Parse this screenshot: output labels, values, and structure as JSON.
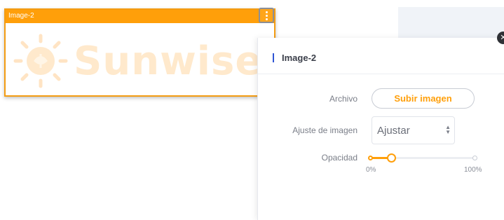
{
  "widget": {
    "title": "Image-2",
    "logo_text": "Sunwise",
    "logo_color": "#ffe9cc",
    "menu_icon": "more-vertical-icon"
  },
  "panel": {
    "title": "Image-2",
    "close_icon": "close-icon",
    "fields": {
      "file_label": "Archivo",
      "upload_label": "Subir imagen",
      "fit_label": "Ajuste de imagen",
      "fit_value": "Ajustar",
      "opacity_label": "Opacidad",
      "opacity_min": "0%",
      "opacity_max": "100%",
      "opacity_value": 0.2
    }
  },
  "colors": {
    "accent": "#ff9f0a",
    "panel_accent": "#2f55d4"
  }
}
